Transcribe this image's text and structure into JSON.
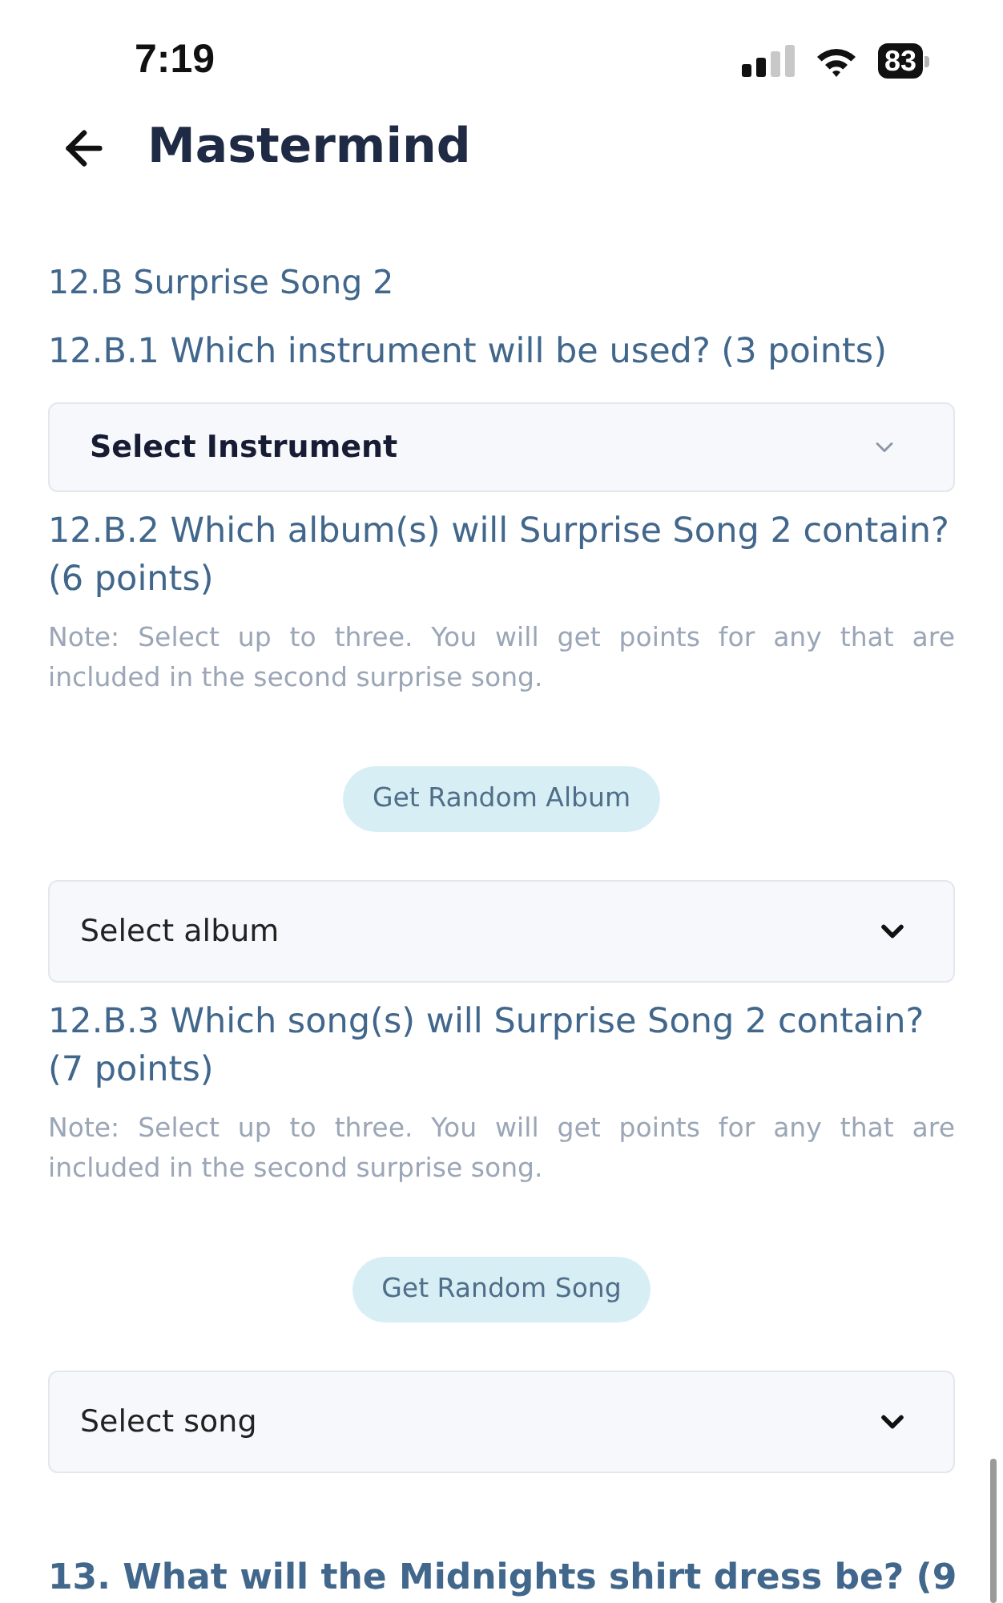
{
  "status_bar": {
    "time": "7:19",
    "battery_percent": "83"
  },
  "header": {
    "title": "Mastermind"
  },
  "section": {
    "title": "12.B Surprise Song 2"
  },
  "questions": [
    {
      "title": "12.B.1 Which instrument will be used? (3 points)",
      "select": {
        "kind": "bold",
        "placeholder": "Select Instrument"
      }
    },
    {
      "title": "12.B.2 Which album(s) will Surprise Song 2 contain? (6 points)",
      "note": "Note: Select up to three. You will get points for any that are included in the second surprise song.",
      "button": "Get Random Album",
      "select": {
        "kind": "plain",
        "placeholder": "Select album"
      }
    },
    {
      "title": "12.B.3 Which song(s) will Surprise Song 2 contain? (7 points)",
      "note": "Note: Select up to three. You will get points for any that are included in the second surprise song.",
      "button": "Get Random Song",
      "select": {
        "kind": "plain",
        "placeholder": "Select song"
      }
    }
  ],
  "next_question": {
    "title": "13. What will the Midnights shirt dress be? (9"
  }
}
